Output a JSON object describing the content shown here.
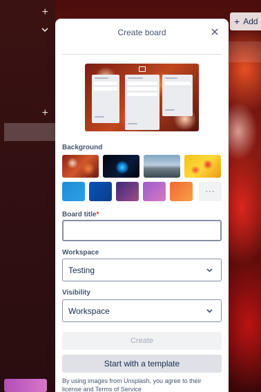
{
  "background_app": {
    "add_list_label": "Add"
  },
  "popover": {
    "title": "Create board",
    "close_icon": "close-icon",
    "preview_icon": "board-icon",
    "background": {
      "label": "Background",
      "photos": [
        "orange-flowers",
        "blue-swirl",
        "mountain-peak",
        "yellow-red-tulips"
      ],
      "colors": [
        "#1f8dd6",
        "#0a52b8",
        "#6a3b8c",
        "#c25fc4",
        "#f06a2e"
      ],
      "more_label": "···"
    },
    "board_title": {
      "label": "Board title",
      "required_mark": "*",
      "value": ""
    },
    "workspace": {
      "label": "Workspace",
      "selected": "Testing"
    },
    "visibility": {
      "label": "Visibility",
      "selected": "Workspace"
    },
    "create_label": "Create",
    "template_label": "Start with a template",
    "footnote": "By using images from Unsplash, you agree to their license and Terms of Service"
  }
}
